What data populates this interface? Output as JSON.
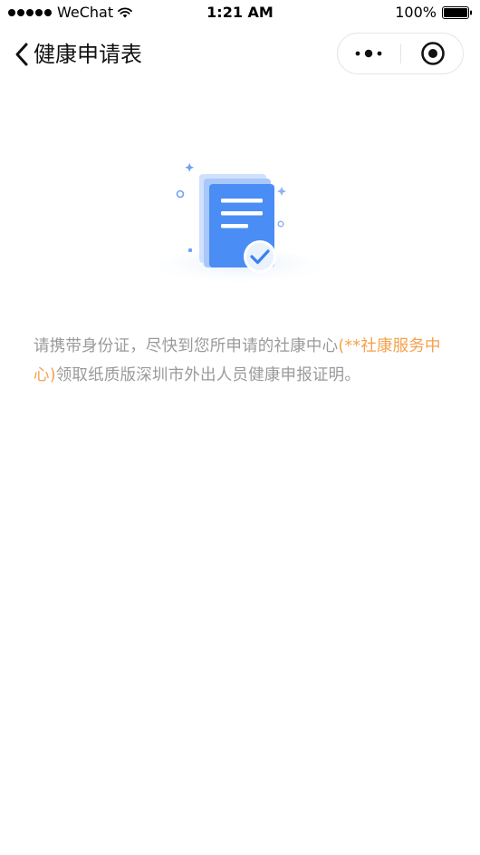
{
  "status_bar": {
    "carrier": "WeChat",
    "time": "1:21 AM",
    "battery": "100%"
  },
  "nav": {
    "title": "健康申请表",
    "back_icon": "chevron-left-icon",
    "more_icon": "more-dots-icon",
    "close_icon": "target-close-icon"
  },
  "illustration": {
    "icon": "document-check-icon",
    "colors": {
      "primary": "#3b82f6",
      "light": "#b7d0fb",
      "accent": "#4a90e2"
    }
  },
  "message": {
    "text_before": "请携带身份证，尽快到您所申请的社康中心",
    "highlight": "(**社康服务中心)",
    "text_after": "领取纸质版深圳市外出人员健康申报证明。",
    "color_normal": "#9a9a9a",
    "color_highlight": "#f5a14a"
  }
}
